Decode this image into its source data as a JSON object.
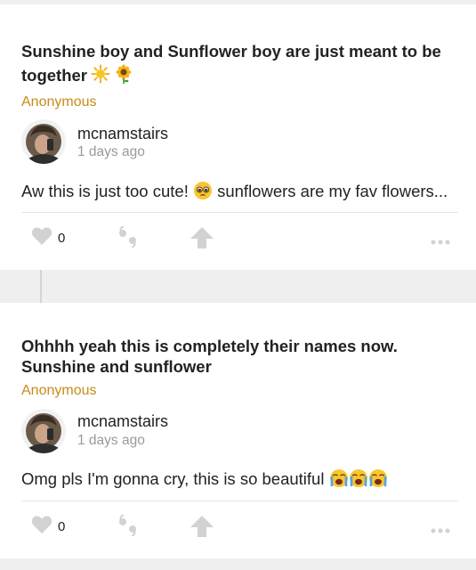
{
  "posts": [
    {
      "title": "Sunshine boy and Sunflower boy are just meant to be together",
      "title_emojis": [
        "sun-emoji",
        "sunflower-emoji"
      ],
      "poster": "Anonymous",
      "comment": {
        "username": "mcnamstairs",
        "time": "1 days ago",
        "text_before": "Aw this is just too cute! ",
        "emoji": "pleading-face-emoji",
        "text_after": " sunflowers are my fav flowers..."
      },
      "actions": {
        "like_count": "0"
      }
    },
    {
      "title": "Ohhhh yeah this is completely their names now. Sunshine and sunflower",
      "poster": "Anonymous",
      "comment": {
        "username": "mcnamstairs",
        "time": "1 days ago",
        "text_before": "Omg pls I'm gonna cry, this is so beautiful ",
        "emojis": [
          "loudly-crying-face-emoji",
          "loudly-crying-face-emoji",
          "loudly-crying-face-emoji"
        ]
      },
      "actions": {
        "like_count": "0"
      }
    }
  ],
  "colors": {
    "accent": "#c98a17",
    "icon": "#d2d2d2",
    "background": "#efefef"
  },
  "icons": [
    "heart-icon",
    "quote-icon",
    "upvote-arrow-icon",
    "more-options-icon"
  ]
}
